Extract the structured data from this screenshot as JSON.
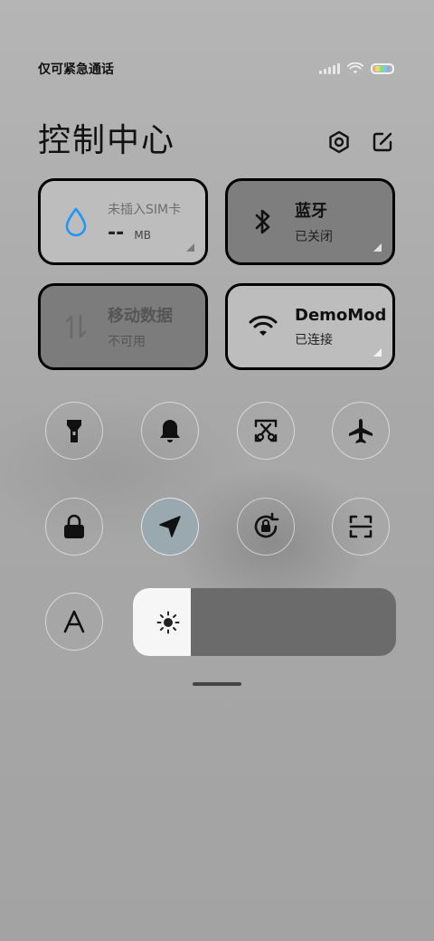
{
  "status": {
    "carrier_text": "仅可紧急通话",
    "battery_level": 0.9
  },
  "header": {
    "title": "控制中心",
    "settings_icon": "hexagon-gear-icon",
    "edit_icon": "edit-icon"
  },
  "tiles": {
    "data_usage": {
      "label": "未插入SIM卡",
      "value": "--",
      "unit": "MB",
      "icon": "water-drop-icon"
    },
    "bluetooth": {
      "label": "蓝牙",
      "state": "已关闭",
      "icon": "bluetooth-icon"
    },
    "mobile_data": {
      "label": "移动数据",
      "state": "不可用",
      "icon": "mobile-data-arrows-icon"
    },
    "wifi": {
      "label": "DemoMode",
      "state": "已连接",
      "icon": "wifi-icon"
    }
  },
  "toggles": [
    {
      "name": "flashlight",
      "icon": "flashlight-icon"
    },
    {
      "name": "mute",
      "icon": "bell-icon"
    },
    {
      "name": "screenshot",
      "icon": "scissors-icon"
    },
    {
      "name": "airplane-mode",
      "icon": "airplane-icon"
    },
    {
      "name": "lock-screen",
      "icon": "lock-icon"
    },
    {
      "name": "location",
      "icon": "location-arrow-icon",
      "active": true
    },
    {
      "name": "rotation-lock",
      "icon": "rotation-lock-icon"
    },
    {
      "name": "scanner",
      "icon": "scan-icon"
    },
    {
      "name": "font-size",
      "icon": "letter-a-icon"
    }
  ],
  "brightness": {
    "level": 0.22,
    "icon": "sun-icon"
  },
  "colors": {
    "accent_blue": "#2196f3",
    "active_toggle": "#9aa8af"
  }
}
